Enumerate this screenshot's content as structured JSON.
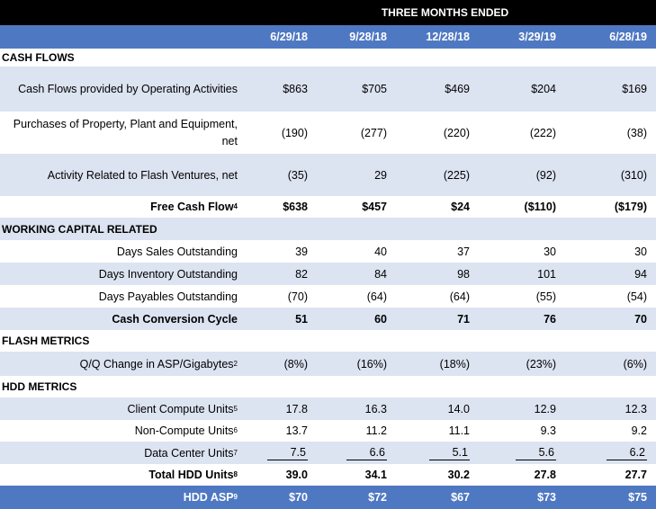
{
  "header": {
    "group_title": "THREE MONTHS ENDED",
    "periods": [
      "6/29/18",
      "9/28/18",
      "12/28/18",
      "3/29/19",
      "6/28/19"
    ]
  },
  "sections": {
    "cash_flows": "CASH FLOWS",
    "working_capital": "WORKING CAPITAL RELATED",
    "flash_metrics": "FLASH METRICS",
    "hdd_metrics": "HDD METRICS"
  },
  "rows": {
    "op_cash": {
      "label": "Cash Flows provided by Operating Activities",
      "values": [
        "$863",
        "$705",
        "$469",
        "$204",
        "$169"
      ]
    },
    "ppe": {
      "label_line1": "Purchases of Property, Plant and Equipment,",
      "label_line2": "net",
      "values": [
        "(190)",
        "(277)",
        "(220)",
        "(222)",
        "(38)"
      ]
    },
    "flash_ventures": {
      "label": "Activity Related to Flash Ventures, net",
      "values": [
        "(35)",
        "29",
        "(225)",
        "(92)",
        "(310)"
      ]
    },
    "fcf": {
      "label": "Free Cash Flow",
      "note": "4",
      "values": [
        "$638",
        "$457",
        "$24",
        "($110)",
        "($179)"
      ]
    },
    "dso": {
      "label": "Days Sales Outstanding",
      "values": [
        "39",
        "40",
        "37",
        "30",
        "30"
      ]
    },
    "dio": {
      "label": "Days Inventory Outstanding",
      "values": [
        "82",
        "84",
        "98",
        "101",
        "94"
      ]
    },
    "dpo": {
      "label": "Days Payables Outstanding",
      "values": [
        "(70)",
        "(64)",
        "(64)",
        "(55)",
        "(54)"
      ]
    },
    "ccc": {
      "label": "Cash Conversion Cycle",
      "values": [
        "51",
        "60",
        "71",
        "76",
        "70"
      ]
    },
    "asp_change": {
      "label": "Q/Q Change in ASP/Gigabytes",
      "note": "2",
      "values": [
        "(8%)",
        "(16%)",
        "(18%)",
        "(23%)",
        "(6%)"
      ]
    },
    "client_compute": {
      "label": "Client Compute Units",
      "note": "5",
      "values": [
        "17.8",
        "16.3",
        "14.0",
        "12.9",
        "12.3"
      ]
    },
    "non_compute": {
      "label": "Non-Compute Units",
      "note": "6",
      "values": [
        "13.7",
        "11.2",
        "11.1",
        "9.3",
        "9.2"
      ]
    },
    "data_center": {
      "label": "Data Center Units",
      "note": "7",
      "values": [
        "7.5",
        "6.6",
        "5.1",
        "5.6",
        "6.2"
      ]
    },
    "total_hdd": {
      "label": "Total HDD Units",
      "note": "8",
      "values": [
        "39.0",
        "34.1",
        "30.2",
        "27.8",
        "27.7"
      ]
    },
    "hdd_asp": {
      "label": "HDD ASP",
      "note": "9",
      "values": [
        "$70",
        "$72",
        "$67",
        "$73",
        "$75"
      ]
    }
  }
}
